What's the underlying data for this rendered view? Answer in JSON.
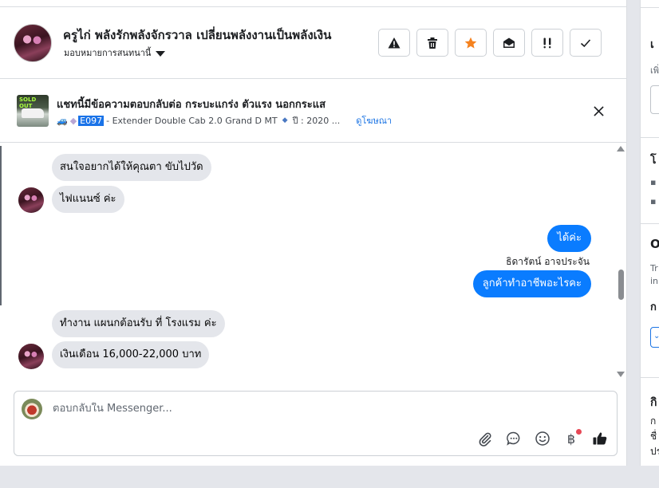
{
  "header": {
    "title": "ครูไก่ พลังรักพลังจักรวาล เปลี่ยนพลังงานเป็นพลังเงิน",
    "subtitle": "มอบหมายการสนทนานี้",
    "actions": [
      {
        "name": "warning",
        "icon": "warning-icon"
      },
      {
        "name": "delete",
        "icon": "trash-icon"
      },
      {
        "name": "star",
        "icon": "star-icon",
        "color": "#f5821f"
      },
      {
        "name": "mark-unread",
        "icon": "envelope-open-icon"
      },
      {
        "name": "follow-up",
        "icon": "double-exclamation-icon"
      },
      {
        "name": "done",
        "icon": "check-icon"
      }
    ]
  },
  "ad": {
    "title": "แชทนี้มีข้อความตอบกลับต่อ กระบะแกร่ง ตัวแรง นอกกระแส",
    "code": "E097",
    "model": "- Extender Double Cab 2.0 Grand D MT",
    "year": "ปี : 2020 ...",
    "link": "ดูโฆษณา",
    "thumb_badge": "SOLD OUT"
  },
  "messages": [
    {
      "dir": "in",
      "text": "สนใจอยากได้ให้คุณตา ขับไปวัด"
    },
    {
      "dir": "in",
      "text": "ไฟแนนซ์ ค่ะ"
    },
    {
      "dir": "out",
      "text": "ได้ค่ะ"
    },
    {
      "dir": "label",
      "text": "ธิดารัตน์ อาจประจัน"
    },
    {
      "dir": "out",
      "text": "ลูกค้าทำอาชีพอะไรคะ"
    },
    {
      "dir": "in",
      "text": "ทำงาน แผนกต้อนรับ ที่ โรงแรม ค่ะ"
    },
    {
      "dir": "in",
      "text": "เงินเดือน 16,000-22,000 บาท"
    }
  ],
  "composer": {
    "placeholder": "ตอบกลับใน Messenger...",
    "tools": [
      "attach-icon",
      "quick-reply-icon",
      "emoji-icon",
      "payment-icon",
      "like-icon"
    ],
    "payment_symbol": "฿"
  },
  "right_panel": {
    "fragments": [
      "เ",
      "เพิ่",
      "โ",
      "O",
      "Tr",
      "inl",
      "ก",
      "กิ",
      "ก",
      "ชื่",
      "ปร"
    ]
  },
  "colors": {
    "accent": "#0a7cff",
    "star": "#f5821f",
    "link": "#1b74e4"
  }
}
